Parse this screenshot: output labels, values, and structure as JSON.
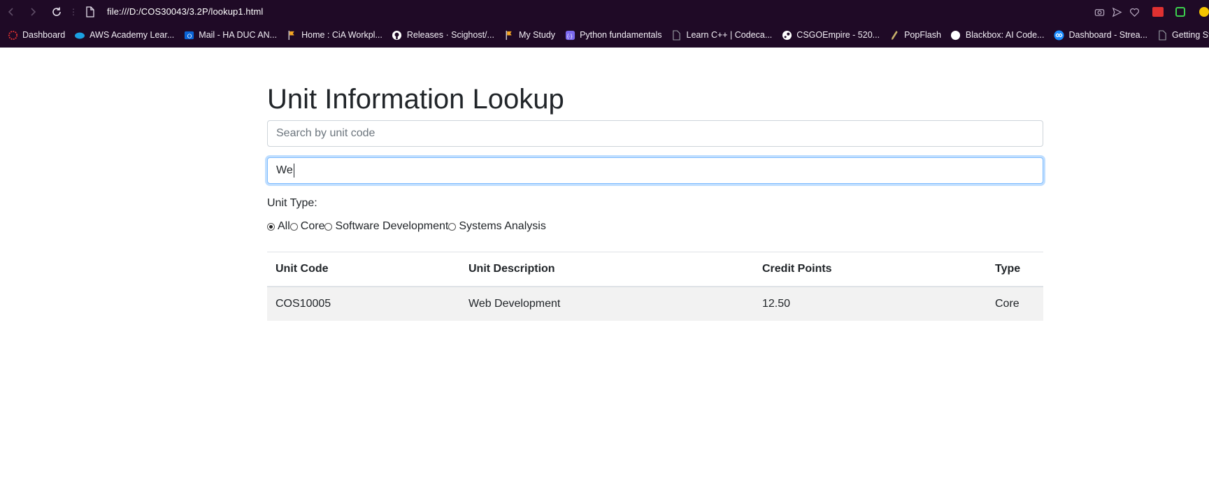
{
  "browser": {
    "url": "file:///D:/COS30043/3.2P/lookup1.html",
    "bookmarks": [
      {
        "label": "Dashboard",
        "icon": "dashboard-icon",
        "color": "#e03131"
      },
      {
        "label": "AWS Academy Lear...",
        "icon": "cloud-icon",
        "color": "#1ba0e2"
      },
      {
        "label": "Mail - HA DUC AN...",
        "icon": "outlook-icon",
        "color": "#0a64d6"
      },
      {
        "label": "Home : CiA Workpl...",
        "icon": "flag-icon",
        "color": "#f5a623"
      },
      {
        "label": "Releases · Scighost/...",
        "icon": "github-icon",
        "color": "#ffffff"
      },
      {
        "label": "My Study",
        "icon": "flag-icon",
        "color": "#f5a623"
      },
      {
        "label": "Python fundamentals",
        "icon": "code-icon",
        "color": "#7b68ee"
      },
      {
        "label": "Learn C++ | Codeca...",
        "icon": "page-icon",
        "color": "#9aa0a6"
      },
      {
        "label": "CSGOEmpire - 520...",
        "icon": "steam-icon",
        "color": "#ffffff"
      },
      {
        "label": "PopFlash",
        "icon": "pen-icon",
        "color": "#c9b26b"
      },
      {
        "label": "Blackbox: AI Code...",
        "icon": "circle-icon",
        "color": "#ffffff"
      },
      {
        "label": "Dashboard - Strea...",
        "icon": "infinity-icon",
        "color": "#1a8cff"
      },
      {
        "label": "Getting Started | Co...",
        "icon": "page-icon",
        "color": "#9aa0a6"
      }
    ]
  },
  "page": {
    "title": "Unit Information Lookup",
    "search_placeholder": "Search by unit code",
    "description_filter_value": "We",
    "unit_type_label": "Unit Type:",
    "unit_types": [
      {
        "label": "All",
        "checked": true
      },
      {
        "label": "Core",
        "checked": false
      },
      {
        "label": "Software Development",
        "checked": false
      },
      {
        "label": "Systems Analysis",
        "checked": false
      }
    ]
  },
  "table": {
    "headers": [
      "Unit Code",
      "Unit Description",
      "Credit Points",
      "Type"
    ],
    "rows": [
      [
        "COS10005",
        "Web Development",
        "12.50",
        "Core"
      ]
    ]
  }
}
